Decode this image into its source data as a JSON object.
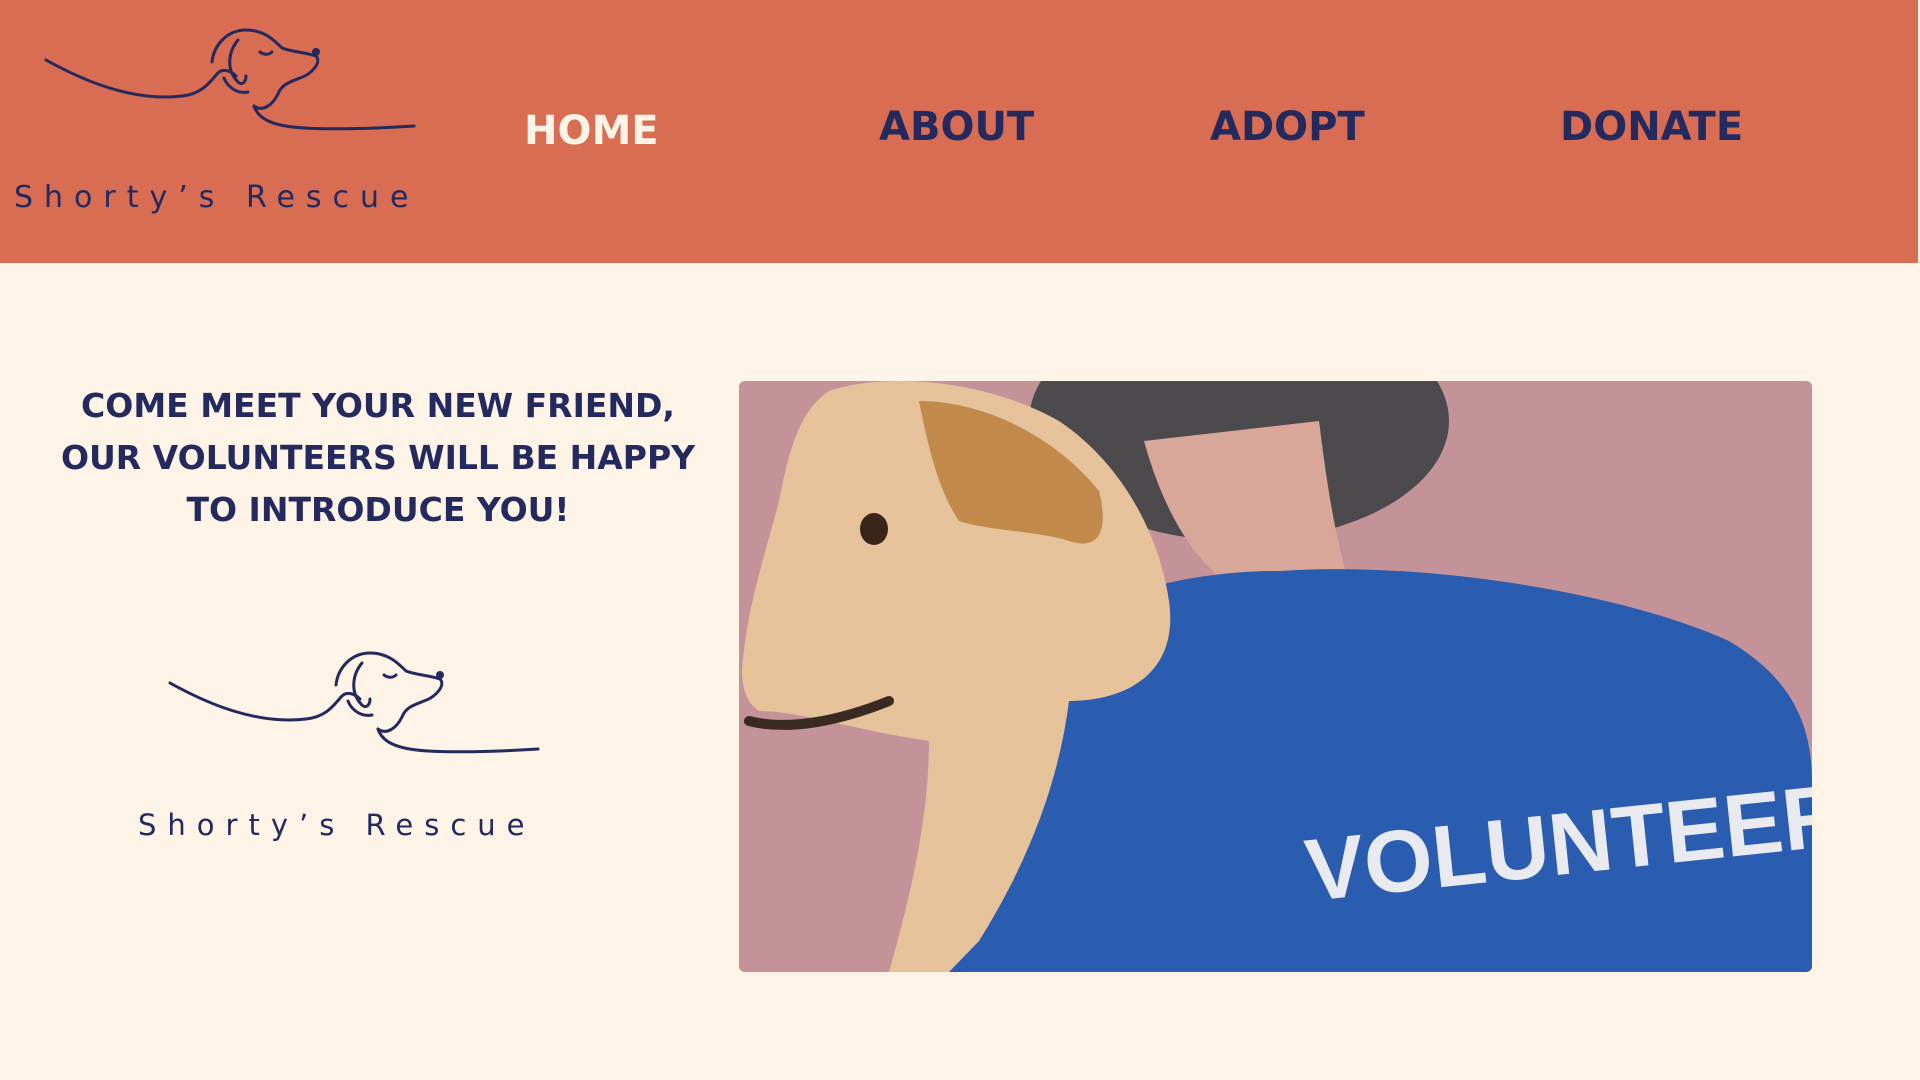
{
  "brand": {
    "name": "Shorty’s Rescue",
    "logo_icon": "dog-line-drawing-icon"
  },
  "nav": {
    "items": [
      {
        "label": "HOME",
        "active": true
      },
      {
        "label": "ABOUT",
        "active": false
      },
      {
        "label": "ADOPT",
        "active": false
      },
      {
        "label": "DONATE",
        "active": false
      }
    ]
  },
  "main": {
    "tagline_lines": [
      "COME MEET YOUR NEW FRIEND,",
      "OUR VOLUNTEERS WILL BE HAPPY",
      "TO INTRODUCE YOU!"
    ],
    "hero_shirt_text": "VOLUNTEER"
  },
  "colors": {
    "header_bg": "#d86d53",
    "page_bg": "#fdf3e6",
    "navy": "#24295e",
    "active_nav": "#fdf3e6",
    "shirt_blue": "#2a5db0"
  }
}
